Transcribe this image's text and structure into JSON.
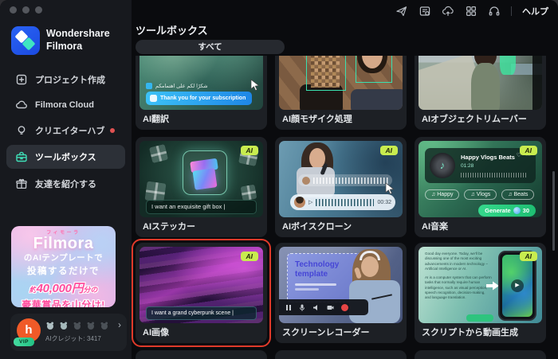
{
  "icons": {
    "music_note": "♪",
    "tag_note": "♫",
    "heart": "♡",
    "more": "⋯",
    "play": "▶",
    "play_outline": "▷",
    "chevron_right": "›"
  },
  "titlebar": {
    "help_label": "ヘルプ"
  },
  "sidebar": {
    "brand_line1": "Wondershare",
    "brand_line2": "Filmora",
    "items": [
      {
        "label": "プロジェクト作成"
      },
      {
        "label": "Filmora Cloud"
      },
      {
        "label": "クリエイターハブ"
      },
      {
        "label": "ツールボックス"
      },
      {
        "label": "友達を紹介する"
      }
    ],
    "promo": {
      "ruby": "フィモーラ",
      "brand": "Filmora",
      "line2": "のAIテンプレートで",
      "line3": "投稿するだけで",
      "amount_prefix": "約",
      "amount": "40,000円",
      "amount_suffix": "分の",
      "line5": "豪華賞品を山分け!"
    },
    "user": {
      "avatar_letter": "h",
      "vip": "VIP",
      "credits_label": "AIクレジット: 3417"
    }
  },
  "main": {
    "title": "ツールボックス",
    "tab_all": "すべて",
    "badge_ai": "AI",
    "cards": {
      "translate": {
        "label": "AI翻訳",
        "arabic": "شكرًا لكم على اهتمامكم",
        "banner": "Thank you for your subscription"
      },
      "mosaic": {
        "label": "AI顔モザイク処理"
      },
      "remover": {
        "label": "AIオブジェクトリムーバー"
      },
      "sticker": {
        "label": "AIステッカー",
        "prompt": "I want an exquisite gift box |"
      },
      "voice": {
        "label": "AIボイスクローン",
        "time": "00:32"
      },
      "music": {
        "label": "AI音楽",
        "song": "Happy Vlogs Beats",
        "duration": "01:28",
        "tags": [
          "Happy",
          "Vlogs",
          "Beats"
        ],
        "generate": "Generate",
        "credits": "30"
      },
      "image": {
        "label": "AI画像",
        "prompt": "I want a grand cyberpunk scene |"
      },
      "recorder": {
        "label": "スクリーンレコーダー",
        "slide_line1": "Technology",
        "slide_line2": "template"
      },
      "script": {
        "label": "スクリプトから動画生成",
        "p1": "Good day everyone. Today, we'll be discussing one of the most exciting advancements in modern technology – Artificial Intelligence or AI.",
        "p2": "AI is a computer system that can perform tasks that normally require human intelligence, such as visual perception, speech recognition, decision-making, and language translation."
      }
    }
  }
}
